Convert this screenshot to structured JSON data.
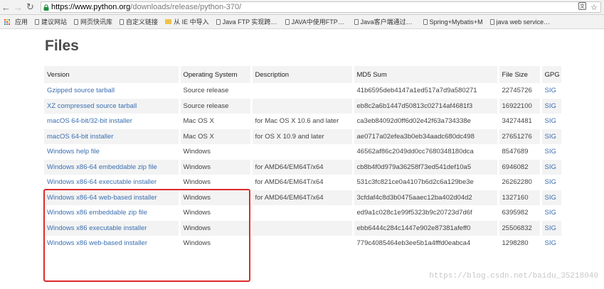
{
  "browser": {
    "url_host": "https://www.python.org",
    "url_path": "/downloads/release/python-370/"
  },
  "bookmarks": [
    {
      "label": "应用",
      "type": "apps"
    },
    {
      "label": "建议网站",
      "type": "page"
    },
    {
      "label": "网页快讯库",
      "type": "page"
    },
    {
      "label": "自定义链接",
      "type": "page"
    },
    {
      "label": "从 IE 中导入",
      "type": "folder"
    },
    {
      "label": "Java FTP 实现跨服务",
      "type": "page"
    },
    {
      "label": "JAVA中使用FTPClie",
      "type": "page"
    },
    {
      "label": "Java客户端通过Http",
      "type": "page"
    },
    {
      "label": "Spring+Mybatis+M",
      "type": "page"
    },
    {
      "label": "java web service 上",
      "type": "page"
    }
  ],
  "page": {
    "title": "Files",
    "columns": [
      "Version",
      "Operating System",
      "Description",
      "MD5 Sum",
      "File Size",
      "GPG"
    ],
    "rows": [
      {
        "version": "Gzipped source tarball",
        "os": "Source release",
        "desc": "",
        "md5": "41b6595deb4147a1ed517a7d9a580271",
        "size": "22745726",
        "gpg": "SIG"
      },
      {
        "version": "XZ compressed source tarball",
        "os": "Source release",
        "desc": "",
        "md5": "eb8c2a6b1447d50813c02714af4681f3",
        "size": "16922100",
        "gpg": "SIG"
      },
      {
        "version": "macOS 64-bit/32-bit installer",
        "os": "Mac OS X",
        "desc": "for Mac OS X 10.6 and later",
        "md5": "ca3eb84092d0ff6d02e42f63a734338e",
        "size": "34274481",
        "gpg": "SIG"
      },
      {
        "version": "macOS 64-bit installer",
        "os": "Mac OS X",
        "desc": "for OS X 10.9 and later",
        "md5": "ae0717a02efea3b0eb34aadc680dc498",
        "size": "27651276",
        "gpg": "SIG"
      },
      {
        "version": "Windows help file",
        "os": "Windows",
        "desc": "",
        "md5": "46562af86c2049dd0cc7680348180dca",
        "size": "8547689",
        "gpg": "SIG"
      },
      {
        "version": "Windows x86-64 embeddable zip file",
        "os": "Windows",
        "desc": "for AMD64/EM64T/x64",
        "md5": "cb8b4f0d979a36258f73ed541def10a5",
        "size": "6946082",
        "gpg": "SIG"
      },
      {
        "version": "Windows x86-64 executable installer",
        "os": "Windows",
        "desc": "for AMD64/EM64T/x64",
        "md5": "531c3fc821ce0a4107b6d2c6a129be3e",
        "size": "26262280",
        "gpg": "SIG"
      },
      {
        "version": "Windows x86-64 web-based installer",
        "os": "Windows",
        "desc": "for AMD64/EM64T/x64",
        "md5": "3cfdaf4c8d3b0475aaec12ba402d04d2",
        "size": "1327160",
        "gpg": "SIG"
      },
      {
        "version": "Windows x86 embeddable zip file",
        "os": "Windows",
        "desc": "",
        "md5": "ed9a1c028c1e99f5323b9c20723d7d6f",
        "size": "6395982",
        "gpg": "SIG"
      },
      {
        "version": "Windows x86 executable installer",
        "os": "Windows",
        "desc": "",
        "md5": "ebb6444c284c1447e902e87381afeff0",
        "size": "25506832",
        "gpg": "SIG"
      },
      {
        "version": "Windows x86 web-based installer",
        "os": "Windows",
        "desc": "",
        "md5": "779c4085464eb3ee5b1a4fffd0eabca4",
        "size": "1298280",
        "gpg": "SIG"
      }
    ]
  },
  "watermark": "https://blog.csdn.net/baidu_35218040",
  "colors": {
    "link": "#3b6fb0",
    "highlight_box": "#e02a2a",
    "lock": "#1e8e3e"
  },
  "icons": [
    "back-arrow-icon",
    "forward-arrow-icon",
    "reload-icon",
    "lock-icon",
    "translate-icon",
    "star-icon",
    "apps-grid-icon",
    "page-icon",
    "folder-icon"
  ]
}
